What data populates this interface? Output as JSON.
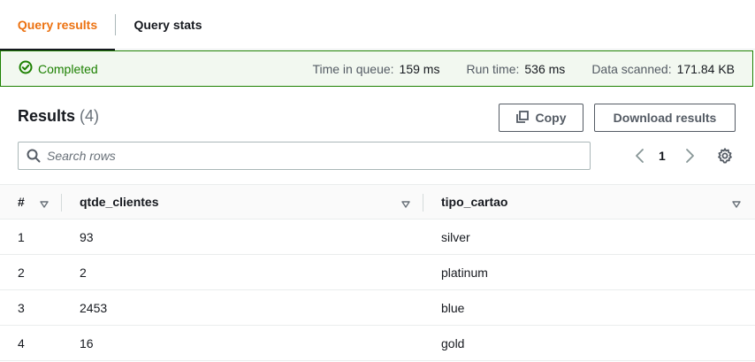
{
  "tabs": [
    {
      "label": "Query results",
      "active": true
    },
    {
      "label": "Query stats",
      "active": false
    }
  ],
  "status": {
    "label": "Completed",
    "icon": "check-circle-icon",
    "color": "#1d8102",
    "queue_label": "Time in queue:",
    "queue_value": "159 ms",
    "run_label": "Run time:",
    "run_value": "536 ms",
    "scanned_label": "Data scanned:",
    "scanned_value": "171.84 KB"
  },
  "results": {
    "title": "Results",
    "count": "(4)",
    "copy_label": "Copy",
    "download_label": "Download results"
  },
  "search": {
    "placeholder": "Search rows",
    "value": ""
  },
  "pagination": {
    "current_page": "1"
  },
  "table": {
    "columns": [
      "#",
      "qtde_clientes",
      "tipo_cartao"
    ],
    "rows": [
      [
        "1",
        "93",
        "silver"
      ],
      [
        "2",
        "2",
        "platinum"
      ],
      [
        "3",
        "2453",
        "blue"
      ],
      [
        "4",
        "16",
        "gold"
      ]
    ]
  },
  "colors": {
    "accent": "#ec7211",
    "success": "#1d8102",
    "success_bg": "#f2f8f0"
  }
}
